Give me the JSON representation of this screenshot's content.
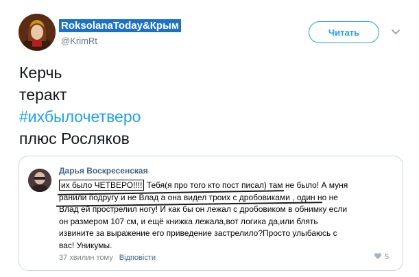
{
  "tweet": {
    "display_name": "RoksolanaToday&Крым",
    "handle": "@KrimRt",
    "follow_label": "Читать",
    "lines": [
      "Керчь",
      "теракт",
      "#ихбылочетверо",
      "плюс Росляков"
    ]
  },
  "embedded_comment": {
    "author": "Дарья Воскресенская",
    "highlight": "их было ЧЕТВЕРО!!!!",
    "lines": [
      "Тебя(я про того кто пост писал) там не было! А муня",
      "ранили подругу и не Влад а она видел троих с дробовиками , один но не",
      "Влад ей прострелил ногу! И как бы он лежал с дробовиком в обнимку если",
      "он размером 107 см, и ещё книжка лежала,вот логика да,или блять",
      "извините за выражение его приведение застрелило?Просто улыбаюсь с",
      "вас! Уникумы."
    ],
    "time": "37 хвилин тому",
    "reply_label": "Відповісти",
    "likes": "5"
  },
  "colors": {
    "accent": "#1da1f2",
    "name_highlight": "#1d72c7",
    "vk_link": "#42648b"
  }
}
